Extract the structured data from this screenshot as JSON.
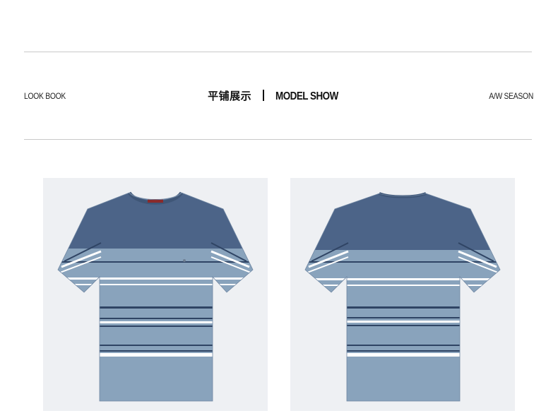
{
  "header": {
    "left_tag": "LOOK BOOK",
    "title_cn": "平铺展示",
    "title_en": "MODEL SHOW",
    "right_tag": "A/W SEASON"
  },
  "colors": {
    "background": "#ffffff",
    "rule": "#c9c9c9",
    "photo_background": "#eef0f3",
    "shirt_yoke_navy": "#4c6488",
    "shirt_body_blue": "#89a3bc",
    "stripe_dark": "#2f4464",
    "stripe_white": "#ffffff"
  },
  "photos": [
    {
      "view": "front",
      "icon": "t-shirt-front-image"
    },
    {
      "view": "back",
      "icon": "t-shirt-back-image"
    }
  ]
}
